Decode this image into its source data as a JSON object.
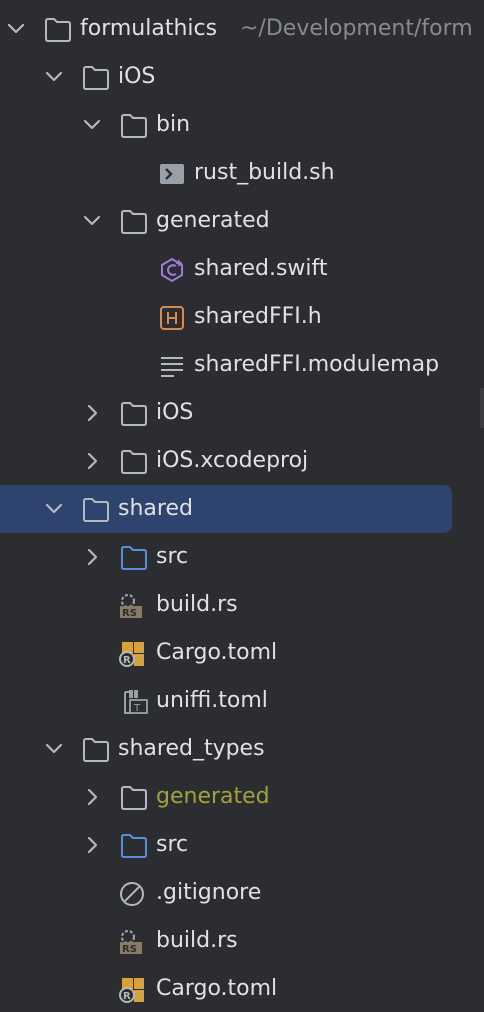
{
  "project": {
    "name": "formulathics",
    "path": "~/Development/form"
  },
  "items": [
    {
      "label": "iOS",
      "type": "folder",
      "expanded": true
    },
    {
      "label": "bin",
      "type": "folder",
      "expanded": true
    },
    {
      "label": "rust_build.sh",
      "type": "file",
      "icon": "shell-script-icon"
    },
    {
      "label": "generated",
      "type": "folder",
      "expanded": true
    },
    {
      "label": "shared.swift",
      "type": "file",
      "icon": "swift-file-icon"
    },
    {
      "label": "sharedFFI.h",
      "type": "file",
      "icon": "c-header-icon"
    },
    {
      "label": "sharedFFI.modulemap",
      "type": "file",
      "icon": "text-file-icon"
    },
    {
      "label": "iOS",
      "type": "folder",
      "expanded": false
    },
    {
      "label": "iOS.xcodeproj",
      "type": "folder",
      "expanded": false
    },
    {
      "label": "shared",
      "type": "folder",
      "expanded": true,
      "selected": true
    },
    {
      "label": "src",
      "type": "source-folder",
      "expanded": false
    },
    {
      "label": "build.rs",
      "type": "file",
      "icon": "rust-build-icon"
    },
    {
      "label": "Cargo.toml",
      "type": "file",
      "icon": "cargo-icon"
    },
    {
      "label": "uniffi.toml",
      "type": "file",
      "icon": "toml-file-icon"
    },
    {
      "label": "shared_types",
      "type": "folder",
      "expanded": true
    },
    {
      "label": "generated",
      "type": "excluded-folder",
      "expanded": false
    },
    {
      "label": "src",
      "type": "source-folder",
      "expanded": false
    },
    {
      "label": ".gitignore",
      "type": "file",
      "icon": "ignore-file-icon"
    },
    {
      "label": "build.rs",
      "type": "file",
      "icon": "rust-build-icon"
    },
    {
      "label": "Cargo.toml",
      "type": "file",
      "icon": "cargo-icon"
    }
  ],
  "colors": {
    "background": "#2b2d30",
    "selection": "#2e436e",
    "text": "#dfe1e5",
    "muted": "#868a91",
    "excluded": "#a1a33a",
    "source_folder": "#5a8fd8"
  }
}
